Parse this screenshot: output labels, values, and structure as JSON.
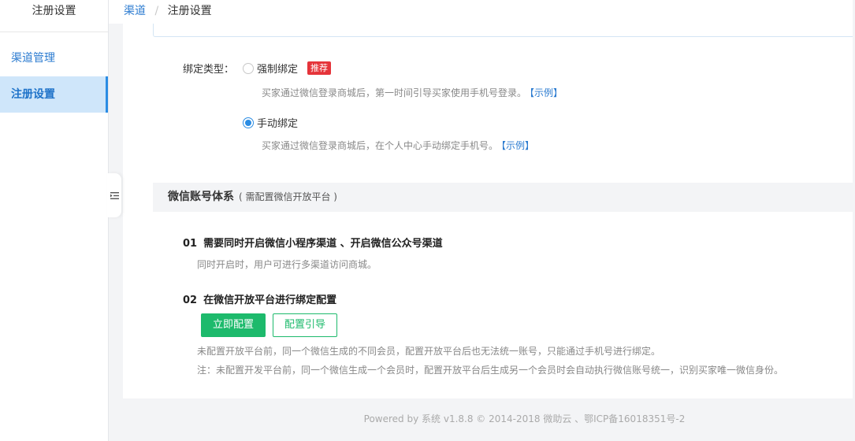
{
  "sidebar": {
    "title": "注册设置",
    "items": [
      {
        "label": "渠道管理",
        "active": false
      },
      {
        "label": "注册设置",
        "active": true
      }
    ]
  },
  "breadcrumb": {
    "parent": "渠道",
    "separator": "/",
    "current": "注册设置"
  },
  "binding": {
    "label": "绑定类型：",
    "options": [
      {
        "label": "强制绑定",
        "badge": "推荐",
        "checked": false,
        "desc": "买家通过微信登录商城后，第一时间引导买家使用手机号登录。",
        "example": "【示例】"
      },
      {
        "label": "手动绑定",
        "badge": "",
        "checked": true,
        "desc": "买家通过微信登录商城后，在个人中心手动绑定手机号。",
        "example": "【示例】"
      }
    ]
  },
  "wechat_section": {
    "title": "微信账号体系",
    "subtitle": "( 需配置微信开放平台 )",
    "steps": [
      {
        "num": "01",
        "title": "需要同时开启微信小程序渠道 、开启微信公众号渠道",
        "desc": "同时开启时，用户可进行多渠道访问商城。"
      },
      {
        "num": "02",
        "title": "在微信开放平台进行绑定配置",
        "desc": ""
      }
    ],
    "buttons": {
      "configure": "立即配置",
      "guide": "配置引导"
    },
    "notes": [
      "未配置开放平台前，同一个微信生成的不同会员，配置开放平台后也无法统一账号，只能通过手机号进行绑定。",
      "注：未配置开发平台前，同一个微信生成一个会员时，配置开放平台后生成另一个会员时会自动执行微信账号统一，识别买家唯一微信身份。"
    ]
  },
  "footer": {
    "text": "Powered by 系统 v1.8.8 © 2014-2018 微助云 、鄂ICP备16018351号-2"
  },
  "colors": {
    "link": "#2b7bd0",
    "primary_green": "#1dba6c",
    "badge_red": "#e5343a",
    "active_bg": "#cfe6fa"
  },
  "icons": {
    "collapse": "collapse-menu-icon"
  }
}
